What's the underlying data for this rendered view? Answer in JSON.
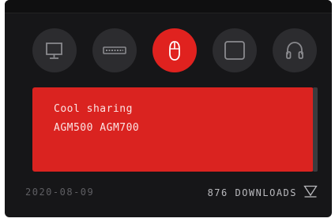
{
  "categories": [
    {
      "icon": "monitor-icon",
      "active": false
    },
    {
      "icon": "keyboard-icon",
      "active": false
    },
    {
      "icon": "mouse-icon",
      "active": true
    },
    {
      "icon": "mousepad-icon",
      "active": false
    },
    {
      "icon": "headphones-icon",
      "active": false
    }
  ],
  "item": {
    "title": "Cool sharing",
    "subtitle": "AGM500 AGM700",
    "date": "2020-08-09",
    "downloads": "876 DOWNLOADS"
  },
  "colors": {
    "accent": "#e0221f",
    "panel": "#da2320",
    "background": "#161618"
  }
}
